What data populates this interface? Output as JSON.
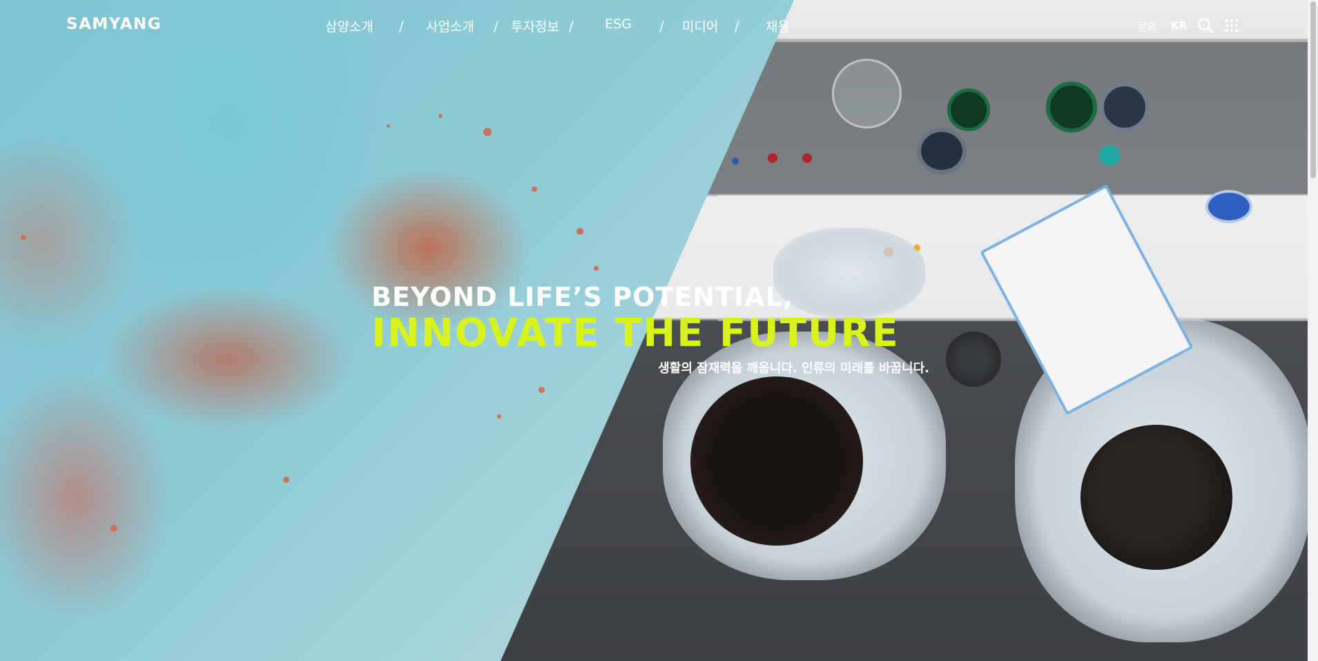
{
  "brand": {
    "logo_text": "SAMYANG"
  },
  "nav": {
    "items": [
      {
        "label": "삼양소개"
      },
      {
        "label": "사업소개"
      },
      {
        "label": "투자정보"
      },
      {
        "label": "ESG"
      },
      {
        "label": "미디어"
      },
      {
        "label": "채용"
      }
    ],
    "separator": "/"
  },
  "utility": {
    "inquiry_label": "문의",
    "language_label": "KR",
    "search_icon": "search-icon",
    "menu_icon": "grid-menu-icon"
  },
  "hero": {
    "headline_line1": "BEYOND LIFE’S POTENTIAL,",
    "headline_line2": "INNOVATE THE FUTURE",
    "subcopy": "생활의 잠재력을 깨웁니다. 인류의 미래를 바꿉니다.",
    "accent_color": "#d8f31c"
  }
}
